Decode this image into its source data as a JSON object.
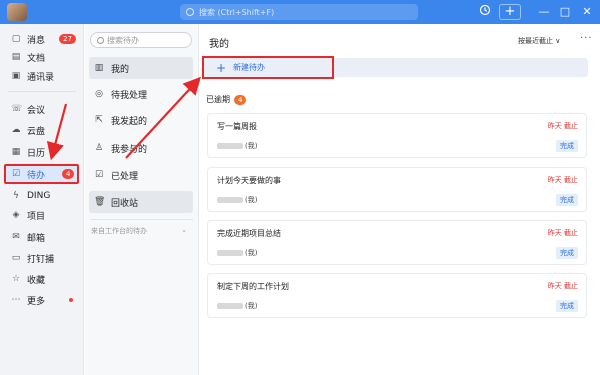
{
  "titlebar": {
    "search_placeholder": "搜索 (Ctrl+Shift+F)",
    "history_icon": "history-icon",
    "new_icon": "+",
    "minimize": "—",
    "maximize": "□",
    "close": "✕"
  },
  "nav": {
    "items": [
      {
        "label": "消息",
        "icon": "chat-icon",
        "badge": "27"
      },
      {
        "label": "文档",
        "icon": "doc-icon"
      },
      {
        "label": "通讯录",
        "icon": "contacts-icon"
      },
      {
        "label": "会议",
        "icon": "meeting-icon"
      },
      {
        "label": "云盘",
        "icon": "cloud-icon"
      },
      {
        "label": "日历",
        "icon": "calendar-icon"
      },
      {
        "label": "待办",
        "icon": "todo-icon",
        "badge": "4",
        "active": true
      },
      {
        "label": "DING",
        "icon": "ding-icon"
      },
      {
        "label": "项目",
        "icon": "project-icon"
      },
      {
        "label": "邮箱",
        "icon": "mail-icon"
      },
      {
        "label": "打钉捕",
        "icon": "pin-icon"
      },
      {
        "label": "收藏",
        "icon": "star-icon"
      },
      {
        "label": "更多",
        "icon": "more-icon"
      }
    ]
  },
  "mid": {
    "search_placeholder": "搜索待办",
    "items": [
      {
        "label": "我的",
        "icon": "inbox-icon"
      },
      {
        "label": "待我处理",
        "icon": "user-icon"
      },
      {
        "label": "我发起的",
        "icon": "share-icon"
      },
      {
        "label": "我参与的",
        "icon": "group-icon"
      },
      {
        "label": "已处理",
        "icon": "check-icon"
      },
      {
        "label": "回收站",
        "icon": "trash-icon"
      }
    ],
    "footer": "来自工作台的待办"
  },
  "main": {
    "title": "我的",
    "sort": "按最近截止 ∨",
    "more": "···",
    "new_label": "新建待办",
    "section": "已逾期",
    "section_count": "4",
    "cards": [
      {
        "title": "写一篇周报",
        "due": "昨天 截止",
        "person": "(我)",
        "status": "完成"
      },
      {
        "title": "计划今天要做的事",
        "due": "昨天 截止",
        "person": "(我)",
        "status": "完成"
      },
      {
        "title": "完成近期项目总结",
        "due": "昨天 截止",
        "person": "(我)",
        "status": "完成"
      },
      {
        "title": "制定下周的工作计划",
        "due": "昨天 截止",
        "person": "(我)",
        "status": "完成"
      }
    ]
  },
  "colors": {
    "titlebar": "#3a86ec",
    "accent": "#2e6fe0",
    "annotation": "#e4292b",
    "overdue": "#e3332d"
  }
}
